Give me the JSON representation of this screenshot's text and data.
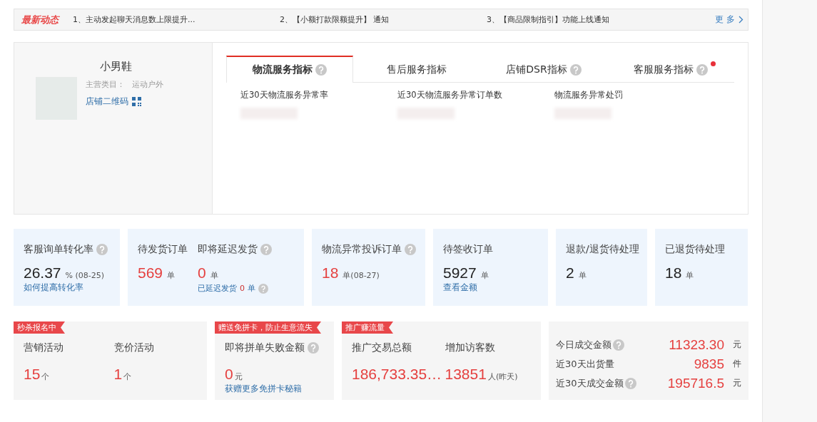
{
  "notice": {
    "title": "最新动态",
    "items": [
      "1、主动发起聊天消息数上限提升...",
      "2、【小额打款限额提升】 通知",
      "3、【商品限制指引】功能上线通知"
    ],
    "more": "更 多"
  },
  "shop": {
    "name": "小男鞋",
    "category_label": "主营类目：",
    "category": "运动户外",
    "qr_link": "店铺二维码"
  },
  "tabs": [
    {
      "label": "物流服务指标",
      "help": true,
      "dot": false,
      "selected": true
    },
    {
      "label": "售后服务指标",
      "help": false,
      "dot": false,
      "selected": false
    },
    {
      "label": "店铺DSR指标",
      "help": true,
      "dot": false,
      "selected": false
    },
    {
      "label": "客服服务指标",
      "help": true,
      "dot": true,
      "selected": false
    }
  ],
  "tab_metrics": [
    "近30天物流服务异常率",
    "近30天物流服务异常订单数",
    "物流服务异常处罚"
  ],
  "stats": [
    {
      "metrics": [
        {
          "label": "客服询单转化率",
          "help": true,
          "value": "26.37",
          "unit": "% (08-25)",
          "highlight": false
        }
      ],
      "link": "如何提高转化率"
    },
    {
      "metrics": [
        {
          "label": "待发货订单",
          "help": false,
          "value": "569",
          "unit": "单",
          "highlight": true
        },
        {
          "label": "即将延迟发货",
          "help": true,
          "value": "0",
          "unit": "单",
          "highlight": true,
          "sub": {
            "text": "已延迟发货",
            "value": "0",
            "unit": "单",
            "help": true
          }
        }
      ]
    },
    {
      "metrics": [
        {
          "label": "物流异常投诉订单",
          "help": true,
          "value": "18",
          "unit": "单(08-27)",
          "highlight": true
        }
      ]
    },
    {
      "metrics": [
        {
          "label": "待签收订单",
          "help": false,
          "value": "5927",
          "unit": "单",
          "highlight": false
        }
      ],
      "link": "查看金额"
    },
    {
      "metrics": [
        {
          "label": "退款/退货待处理",
          "help": false,
          "value": "2",
          "unit": "单",
          "highlight": false
        }
      ]
    },
    {
      "metrics": [
        {
          "label": "已退货待处理",
          "help": false,
          "value": "18",
          "unit": "单",
          "highlight": false
        }
      ]
    }
  ],
  "promos": [
    {
      "ribbon": "秒杀报名中",
      "metrics": [
        {
          "label": "营销活动",
          "help": false,
          "value": "15",
          "unit": "个"
        },
        {
          "label": "竞价活动",
          "help": false,
          "value": "1",
          "unit": "个"
        }
      ]
    },
    {
      "ribbon": "赠送免拼卡，防止生意流失",
      "metrics": [
        {
          "label": "即将拼单失败金额",
          "help": true,
          "value": "0",
          "unit": "元"
        }
      ],
      "link": "获赠更多免拼卡秘籍"
    },
    {
      "ribbon": "推广赚流量",
      "metrics": [
        {
          "label": "推广交易总额",
          "help": false,
          "value": "186,733.35…"
        },
        {
          "label": "增加访客数",
          "help": false,
          "value": "13851",
          "unit": "人(昨天)"
        }
      ]
    }
  ],
  "summary": [
    {
      "label": "今日成交金额",
      "help": true,
      "value": "11323.30",
      "unit": "元"
    },
    {
      "label": "近30天出货量",
      "help": false,
      "value": "9835",
      "unit": "件"
    },
    {
      "label": "近30天成交金额",
      "help": true,
      "value": "195716.5",
      "unit": "元"
    }
  ]
}
